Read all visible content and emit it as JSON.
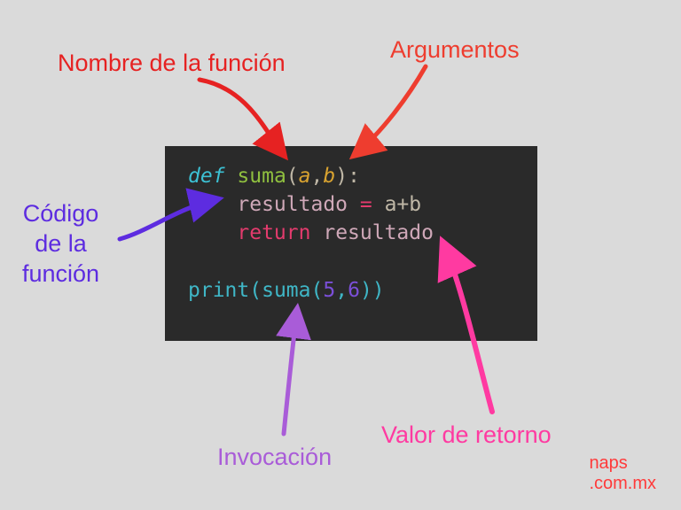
{
  "labels": {
    "function_name": "Nombre de la función",
    "arguments": "Argumentos",
    "function_body": "Código\nde la\nfunción",
    "return_value": "Valor de retorno",
    "invocation": "Invocación"
  },
  "code": {
    "def": "def",
    "fn": "suma",
    "lparen": "(",
    "arg_a": "a",
    "comma": ",",
    "arg_b": "b",
    "rparen_colon": "):",
    "indent": "    ",
    "var": "resultado",
    "eq": " = ",
    "expr": "a+b",
    "ret": "return",
    "sp": " ",
    "retvar": "resultado",
    "print": "print",
    "call_l": "(",
    "call_fn": "suma",
    "call_lp": "(",
    "n1": "5",
    "c2": ",",
    "n2": "6",
    "call_rp": ")",
    "call_r": ")"
  },
  "colors": {
    "red": "#e62222",
    "redorange": "#ee3d2f",
    "purple": "#5d2ce0",
    "magenta": "#ff3aa1",
    "violet": "#a95cd8"
  },
  "watermark": {
    "line1": "naps",
    "line2": ".com.mx"
  }
}
